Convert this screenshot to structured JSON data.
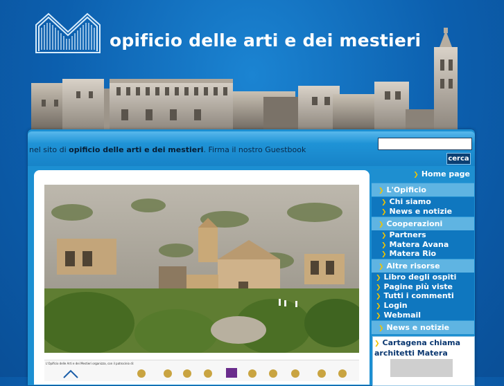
{
  "header": {
    "title": "opificio delle arti e dei mestieri"
  },
  "topbar": {
    "welcome_prefix": "nel sito di",
    "welcome_site": "opificio delle arti e dei mestieri",
    "welcome_suffix": ". Firma il nostro Guestbook",
    "search_placeholder": "",
    "search_button": "cerca"
  },
  "content": {
    "sponsor_caption": "L'Opificio delle Arti e dei Mestieri organizza, con il patrocinio di:"
  },
  "sidebar": {
    "home": "Home page",
    "sections": [
      {
        "title": "L'Opificio",
        "items": [
          "Chi siamo",
          "News e notizie"
        ]
      },
      {
        "title": "Cooperazioni",
        "items": [
          "Partners",
          "Matera Avana",
          "Matera Rio"
        ]
      },
      {
        "title": "Altre risorse",
        "items": [
          "Libro degli ospiti",
          "Pagine più viste",
          "Tutti i commenti",
          "Login",
          "Webmail"
        ]
      },
      {
        "title": "News e notizie",
        "items": []
      }
    ],
    "news": {
      "headline": "Cartagena chiama architetti Matera"
    }
  },
  "colors": {
    "background": "#0c5fae",
    "accent": "#f1c400",
    "panel": "#1e8fd0",
    "section": "#5fb4e2"
  }
}
